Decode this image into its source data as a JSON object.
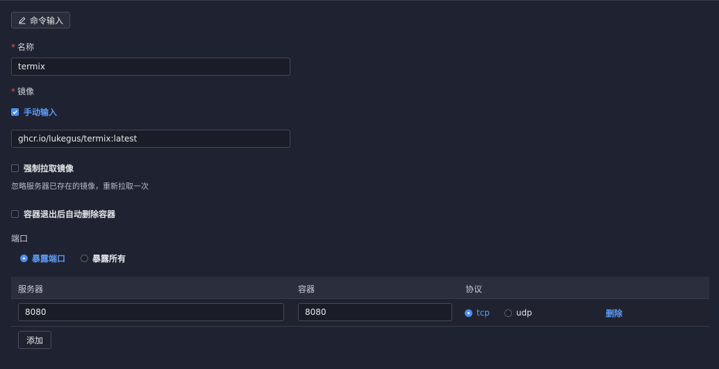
{
  "toolbar": {
    "command_input_label": "命令输入"
  },
  "form": {
    "name": {
      "label": "名称",
      "required_mark": "*",
      "value": "termix"
    },
    "image": {
      "label": "镜像",
      "required_mark": "*",
      "manual_input_label": "手动输入",
      "manual_input_checked": true,
      "value": "ghcr.io/lukegus/termix:latest"
    },
    "force_pull": {
      "label": "强制拉取镜像",
      "checked": false,
      "hint": "忽略服务器已存在的镜像，重新拉取一次"
    },
    "auto_remove": {
      "label": "容器退出后自动删除容器",
      "checked": false
    },
    "ports": {
      "label": "端口",
      "mode_expose_ports": "暴露端口",
      "mode_expose_all": "暴露所有",
      "selected_mode": "暴露端口",
      "table": {
        "headers": [
          "服务器",
          "容器",
          "协议"
        ],
        "rows": [
          {
            "server": "8080",
            "container": "8080",
            "protocol_tcp": "tcp",
            "protocol_udp": "udp",
            "selected_protocol": "tcp",
            "delete_label": "删除"
          }
        ]
      },
      "add_label": "添加"
    }
  },
  "colors": {
    "background": "#1f2231",
    "accent": "#4d8ef0",
    "required": "#e0584f"
  },
  "icons": {
    "command_input": "edit-pencil-icon"
  }
}
